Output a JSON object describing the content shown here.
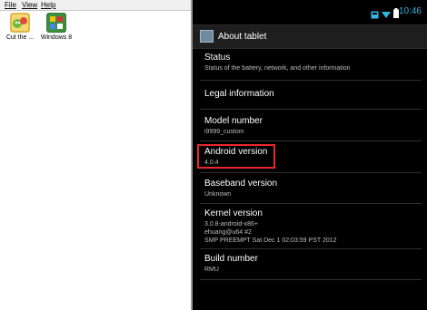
{
  "host": {
    "menu": [
      "File",
      "View",
      "Help"
    ],
    "icons": [
      {
        "label": "Cut the ...",
        "icon": "cut-the-rope-icon"
      },
      {
        "label": "Windows 8",
        "icon": "windows-8-icon"
      }
    ]
  },
  "android": {
    "status_bar": {
      "time": "10:46",
      "icons": [
        "notification-icon",
        "wifi-icon",
        "battery-icon"
      ],
      "accent": "#33b5e5"
    },
    "action_bar": {
      "title": "About tablet",
      "icon": "settings-app-icon"
    },
    "items": [
      {
        "title": "Status",
        "subtitle": "Status of the battery, network, and other information"
      },
      {
        "title": "Legal information",
        "subtitle": ""
      },
      {
        "title": "Model number",
        "subtitle": "i9999_custom"
      },
      {
        "title": "Android version",
        "subtitle": "4.0.4"
      },
      {
        "title": "Baseband version",
        "subtitle": "Unknown"
      },
      {
        "title": "Kernel version",
        "subtitle_lines": [
          "3.0.8-android-x86+",
          "ehuang@u64 #2",
          "SMP PREEMPT Sat Dec 1 02:03:59 PST 2012"
        ]
      },
      {
        "title": "Build number",
        "subtitle": "RMU"
      }
    ],
    "highlight_color": "#e8262b"
  }
}
